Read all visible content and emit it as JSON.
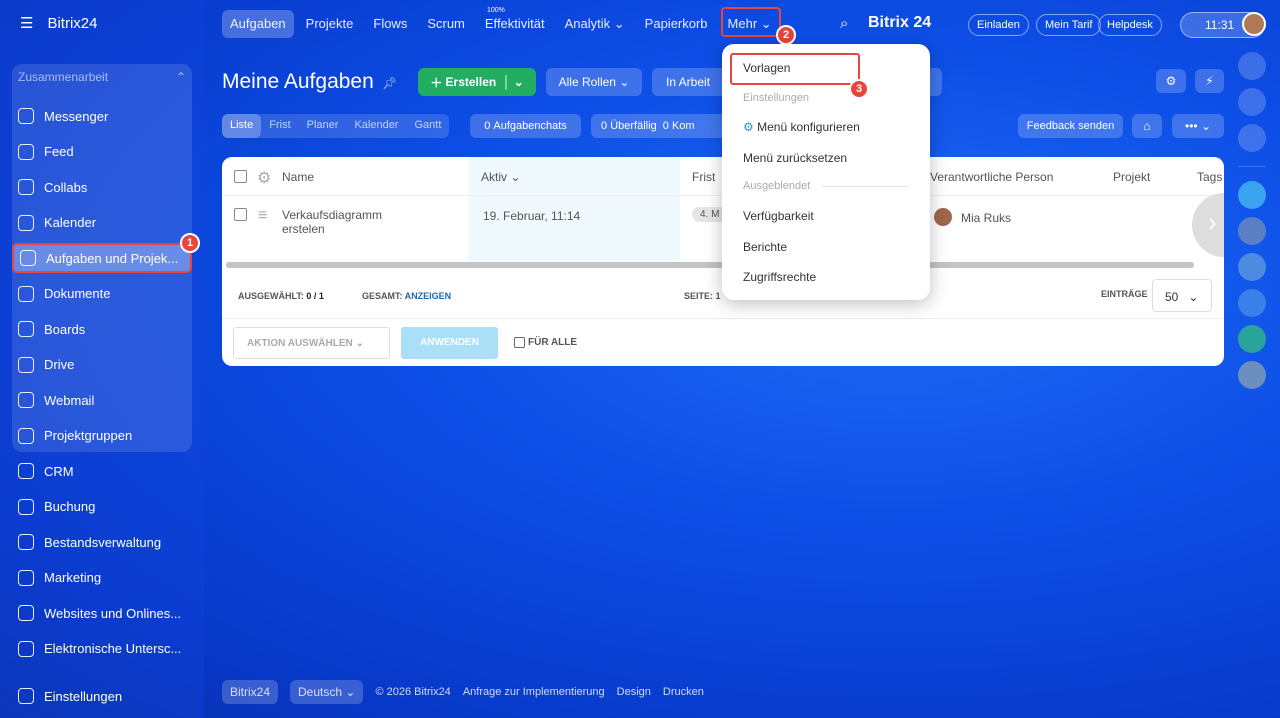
{
  "sidebar": {
    "logo": "Bitrix24",
    "group": "Zusammenarbeit",
    "items": [
      "Messenger",
      "Feed",
      "Collabs",
      "Kalender",
      "Aufgaben und Projek...",
      "Dokumente",
      "Boards",
      "Drive",
      "Webmail",
      "Projektgruppen",
      "CRM",
      "Buchung",
      "Bestandsverwaltung",
      "Marketing",
      "Websites und Onlines...",
      "Elektronische Untersc...",
      "Einstellungen"
    ]
  },
  "topnav": {
    "items": [
      "Aufgaben",
      "Projekte",
      "Flows",
      "Scrum",
      "Effektivität",
      "Analytik",
      "Papierkorb",
      "Mehr"
    ],
    "effektivitaet_pct": "100%",
    "brand": "Bitrix 24",
    "invite": "Einladen",
    "tariff": "Mein Tarif",
    "helpdesk": "Helpdesk",
    "time": "11:31"
  },
  "page": {
    "title": "Meine Aufgaben",
    "create": "Erstellen",
    "roles": "Alle Rollen",
    "filter": "In Arbeit",
    "views": [
      "Liste",
      "Frist",
      "Planer",
      "Kalender",
      "Gantt"
    ],
    "chats_count": "0",
    "chats": "Aufgabenchats",
    "overdue_count": "0",
    "overdue": "Überfällig",
    "comments_count": "0",
    "comments": "Kom",
    "feedback": "Feedback senden"
  },
  "table": {
    "columns": [
      "Name",
      "Aktiv",
      "Frist",
      "Verantwortliche Person",
      "Projekt",
      "Tags"
    ],
    "rows": [
      {
        "name": "Verkaufsdiagramm erstelen",
        "active": "19. Februar, 11:14",
        "deadline": "4. M",
        "person": "Mia Ruks"
      }
    ],
    "selected_label": "AUSGEWÄHLT:",
    "selected": "0 / 1",
    "total_label": "GESAMT:",
    "total_link": "ANZEIGEN",
    "page_label": "SEITE:",
    "page": "1",
    "entries_label": "EINTRÄGE",
    "entries": "50",
    "action": "AKTION AUSWÄHLEN",
    "apply": "ANWENDEN",
    "for_all": "FÜR ALLE"
  },
  "menu": {
    "templates": "Vorlagen",
    "settings": "Einstellungen",
    "configure": "Menü konfigurieren",
    "reset": "Menü zurücksetzen",
    "hidden": "Ausgeblendet",
    "availability": "Verfügbarkeit",
    "reports": "Berichte",
    "access": "Zugriffsrechte"
  },
  "steps": [
    "1",
    "2",
    "3"
  ],
  "footer": {
    "brand": "Bitrix24",
    "lang": "Deutsch",
    "copyright": "© 2026 Bitrix24",
    "impl": "Anfrage zur Implementierung",
    "design": "Design",
    "print": "Drucken"
  }
}
